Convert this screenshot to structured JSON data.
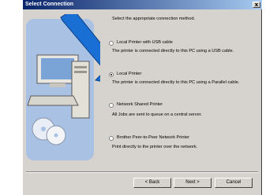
{
  "window": {
    "title": "Select Connection",
    "close_label": "x"
  },
  "instruction": "Select the appropriate connection method.",
  "options": [
    {
      "label": "Local Printer with USB cable",
      "description": "The printer is connected directly to this PC using a USB cable.",
      "selected": false
    },
    {
      "label": "Local Printer",
      "description": "The printer is connected directly to this PC using a Parallel cable.",
      "selected": true
    },
    {
      "label": "Network Shared Printer",
      "description": "All Jobs are sent to queue on a central server.",
      "selected": false
    },
    {
      "label": "Brother Peer-to-Peer Network Printer",
      "description": "Print directly to the printer over the network.",
      "selected": false
    }
  ],
  "buttons": {
    "back": "< Back",
    "next": "Next >",
    "cancel": "Cancel"
  },
  "colors": {
    "dialog_bg": "#d6d3ce",
    "titlebar": "#0a246a",
    "arrow": "#1a6fd4"
  }
}
